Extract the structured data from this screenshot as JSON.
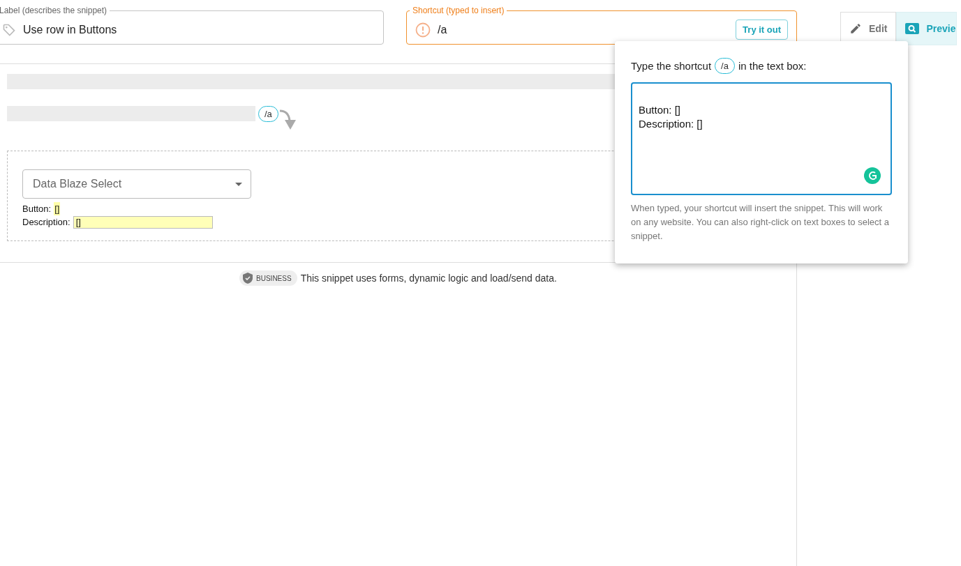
{
  "label_field": {
    "legend": "Label (describes the snippet)",
    "value": "Use row in Buttons"
  },
  "shortcut_field": {
    "legend": "Shortcut (typed to insert)",
    "value": "/a",
    "warning": true,
    "button": "Try it out"
  },
  "tabs": [
    {
      "label": "Edit",
      "selected": false,
      "kind": "edit"
    },
    {
      "label": "Previe",
      "selected": true,
      "kind": "preview"
    }
  ],
  "preview": {
    "shortcut_chip": "/a",
    "select": {
      "value": "Data Blaze Select"
    },
    "fields": [
      {
        "label": "Button:",
        "value": "[]",
        "kind": "inline"
      },
      {
        "label": "Description:",
        "value": "[]",
        "kind": "input"
      }
    ]
  },
  "footer": {
    "badge": "BUSINESS",
    "text": "This snippet uses forms, dynamic logic and load/send data."
  },
  "popover": {
    "prompt_before": "Type the shortcut",
    "chip": "/a",
    "prompt_after": "in the text box:",
    "textarea_value": "\nButton: []\nDescription: []",
    "help": "When typed, your shortcut will insert the snippet. This will work on any website. You can also right-click on text boxes to select a snippet."
  }
}
